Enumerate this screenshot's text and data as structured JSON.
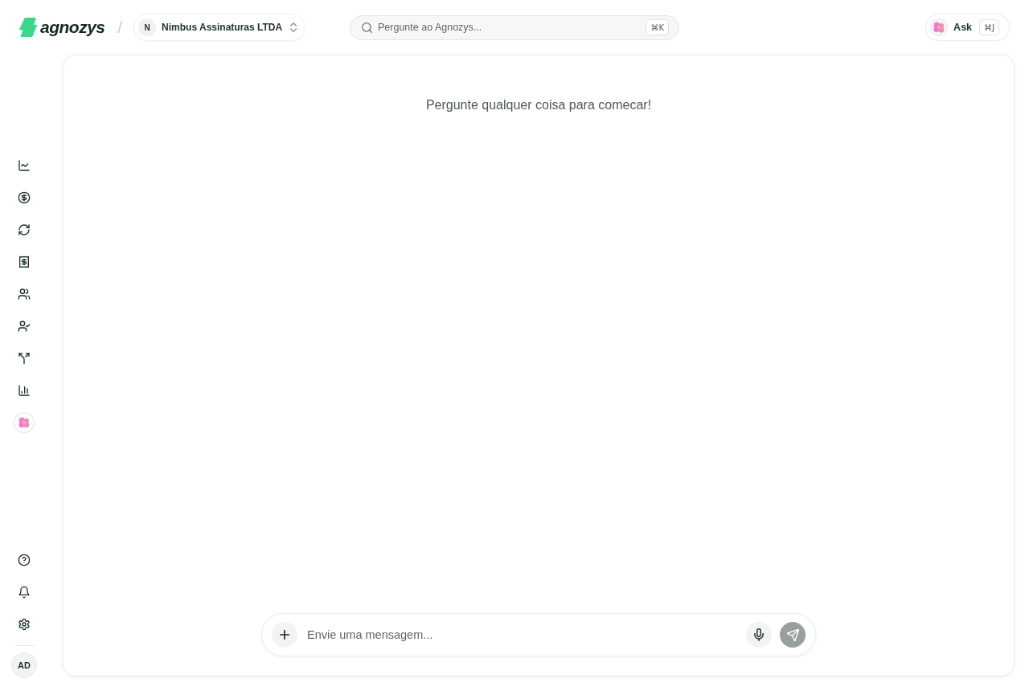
{
  "header": {
    "logo": "agnozys",
    "separator": "/",
    "workspace": {
      "initial": "N",
      "name": "Nimbus Assinaturas LTDA"
    },
    "search": {
      "placeholder": "Pergunte ao Agnozys...",
      "shortcut": "⌘K"
    },
    "ask": {
      "label": "Ask",
      "shortcut": "⌘J"
    }
  },
  "sidebar": {
    "user": {
      "initials": "AD"
    }
  },
  "main": {
    "prompt": "Pergunte qualquer coisa para comecar!",
    "composer": {
      "placeholder": "Envie uma mensagem...",
      "send_disabled": true
    }
  }
}
